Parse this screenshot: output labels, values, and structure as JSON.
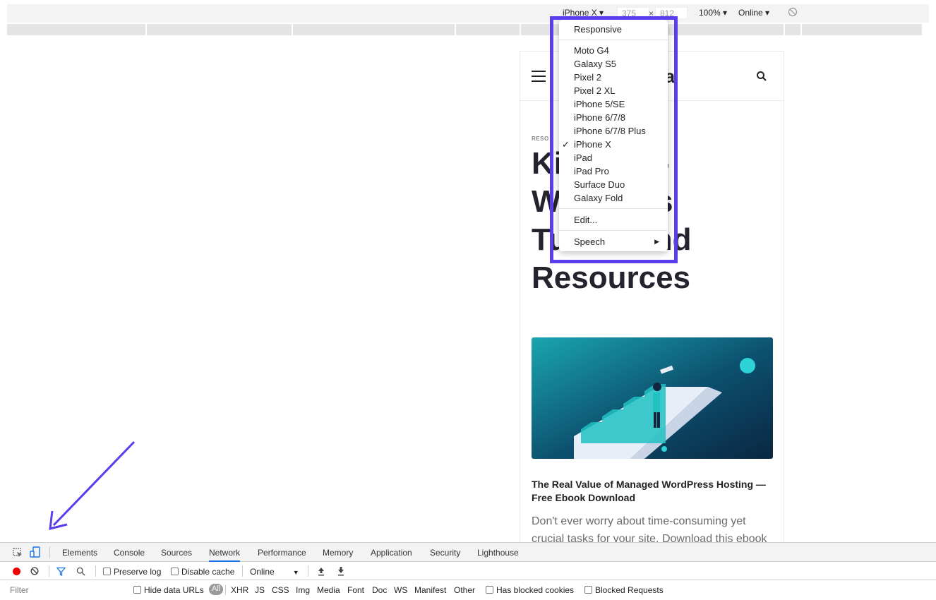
{
  "device_toolbar": {
    "device": "iPhone X",
    "width": "375",
    "times": "×",
    "height": "812",
    "zoom": "100%",
    "throttle": "Online"
  },
  "site": {
    "logo_partial": "ta",
    "category": "RESO",
    "title_lines": [
      "Ki        g -",
      "W           s",
      "Tu          nd",
      "Resources"
    ],
    "ebook_title": "The Real Value of Managed WordPress Hosting — Free Ebook Download",
    "ebook_desc": "Don't ever worry about time-consuming yet crucial tasks for your site. Download this ebook"
  },
  "device_menu": {
    "responsive": "Responsive",
    "devices": [
      "Moto G4",
      "Galaxy S5",
      "Pixel 2",
      "Pixel 2 XL",
      "iPhone 5/SE",
      "iPhone 6/7/8",
      "iPhone 6/7/8 Plus",
      "iPhone X",
      "iPad",
      "iPad Pro",
      "Surface Duo",
      "Galaxy Fold"
    ],
    "selected_check": "✓",
    "edit": "Edit...",
    "speech": "Speech"
  },
  "devtools": {
    "tabs": [
      "Elements",
      "Console",
      "Sources",
      "Network",
      "Performance",
      "Memory",
      "Application",
      "Security",
      "Lighthouse"
    ],
    "active_tab": "Network",
    "network_toolbar": {
      "preserve_log": "Preserve log",
      "disable_cache": "Disable cache",
      "throttle": "Online"
    },
    "filter": {
      "placeholder": "Filter",
      "hide_data_urls": "Hide data URLs",
      "all": "All",
      "types": [
        "XHR",
        "JS",
        "CSS",
        "Img",
        "Media",
        "Font",
        "Doc",
        "WS",
        "Manifest",
        "Other"
      ],
      "has_blocked_cookies": "Has blocked cookies",
      "blocked_requests": "Blocked Requests"
    }
  },
  "colors": {
    "highlight": "#5b3ded",
    "active_tab": "#1a73e8",
    "record": "#ee0000"
  }
}
